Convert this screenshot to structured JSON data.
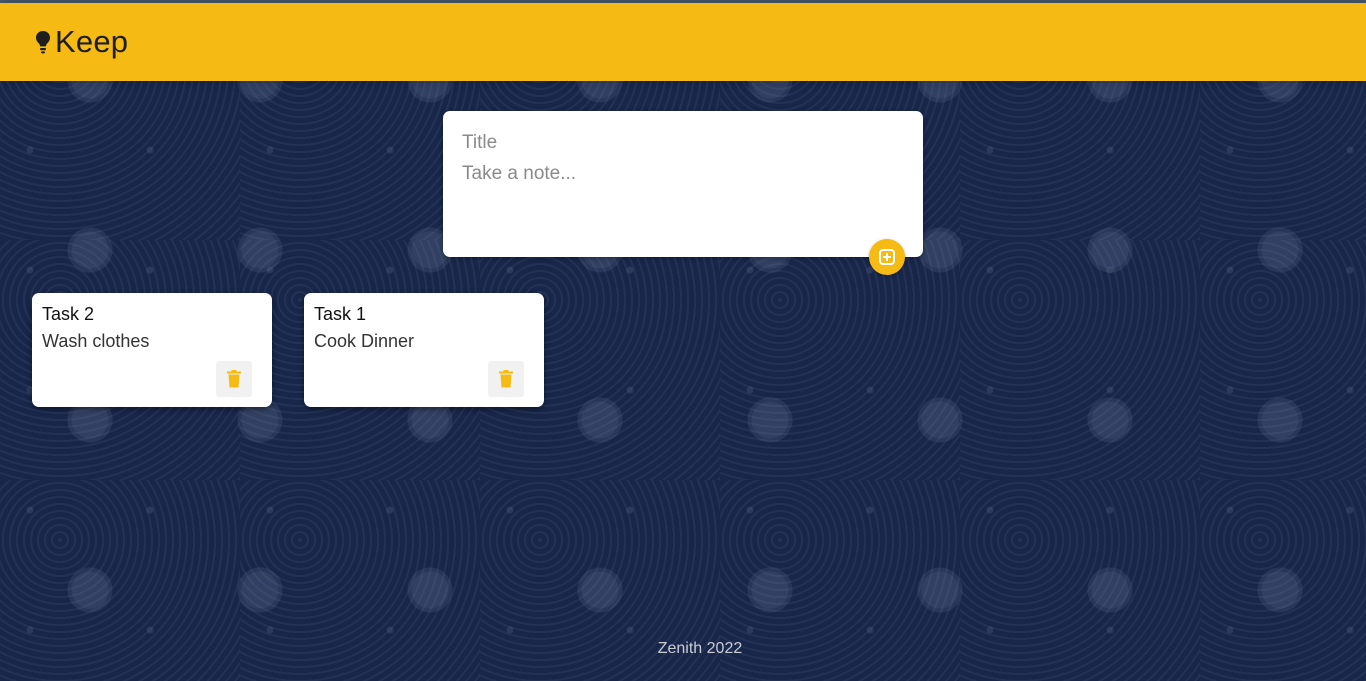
{
  "header": {
    "app_name": "Keep"
  },
  "create_note": {
    "title_placeholder": "Title",
    "content_placeholder": "Take a note...",
    "title_value": "",
    "content_value": ""
  },
  "notes": [
    {
      "title": "Task 2",
      "content": "Wash clothes"
    },
    {
      "title": "Task 1",
      "content": "Cook Dinner"
    }
  ],
  "footer": {
    "text": "Zenith 2022"
  },
  "icons": {
    "logo": "lightbulb-icon",
    "add": "add-box-icon",
    "delete": "trash-icon"
  },
  "colors": {
    "accent": "#f5ba13",
    "background": "#18264a",
    "card": "#ffffff"
  }
}
